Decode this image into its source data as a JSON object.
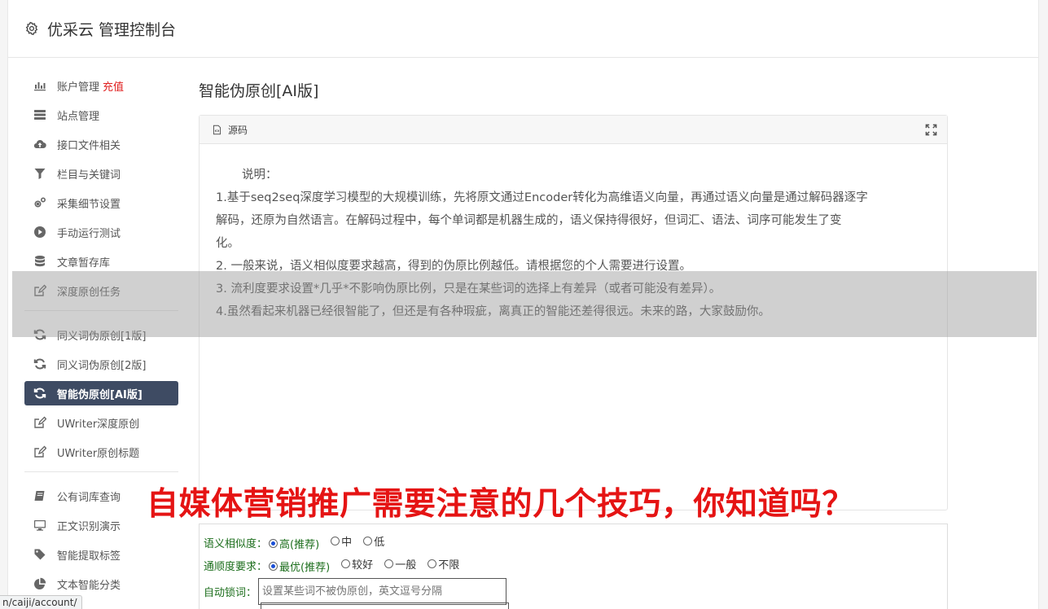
{
  "header": {
    "icon": "gear-icon",
    "title": "优采云 管理控制台"
  },
  "sidebar": {
    "group1": [
      {
        "icon": "bar-chart-icon",
        "label": "账户管理",
        "extra": "充值"
      },
      {
        "icon": "server-icon",
        "label": "站点管理"
      },
      {
        "icon": "cloud-upload-icon",
        "label": "接口文件相关"
      },
      {
        "icon": "filter-icon",
        "label": "栏目与关键词"
      },
      {
        "icon": "cogs-icon",
        "label": "采集细节设置"
      },
      {
        "icon": "play-circle-icon",
        "label": "手动运行测试"
      },
      {
        "icon": "database-icon",
        "label": "文章暂存库"
      },
      {
        "icon": "edit-icon",
        "label": "深度原创任务"
      }
    ],
    "group2": [
      {
        "icon": "refresh-icon",
        "label": "同义词伪原创[1版]"
      },
      {
        "icon": "refresh-icon",
        "label": "同义词伪原创[2版]"
      },
      {
        "icon": "refresh-icon",
        "label": "智能伪原创[AI版]",
        "active": true
      },
      {
        "icon": "edit-icon",
        "label": "UWriter深度原创"
      },
      {
        "icon": "edit-icon",
        "label": "UWriter原创标题"
      }
    ],
    "group3": [
      {
        "icon": "book-icon",
        "label": "公有词库查询"
      },
      {
        "icon": "monitor-icon",
        "label": "正文识别演示"
      },
      {
        "icon": "tag-icon",
        "label": "智能提取标签"
      },
      {
        "icon": "pie-chart-icon",
        "label": "文本智能分类"
      }
    ]
  },
  "main": {
    "page_title": "智能伪原创[AI版]",
    "panel": {
      "tab_label": "源码",
      "description_title": "说明：",
      "lines": [
        "1.基于seq2seq深度学习模型的大规模训练，先将原文通过Encoder转化为高维语义向量，再通过语义向量是通过解码器逐字",
        "解码，还原为自然语言。在解码过程中，每个单词都是机器生成的，语义保持得很好，但词汇、语法、词序可能发生了变",
        "化。",
        "2. 一般来说，语义相似度要求越高，得到的伪原比例越低。请根据您的个人需要进行设置。",
        "3. 流利度要求设置*几乎*不影响伪原比例，只是在某些词的选择上有差异（或者可能没有差异）。",
        "4.虽然看起来机器已经很智能了，但还是有各种瑕疵，离真正的智能还差得很远。未来的路，大家鼓励你。"
      ]
    },
    "options": {
      "similarity": {
        "label": "语义相似度：",
        "choices": [
          {
            "text": "高(推荐)",
            "checked": true
          },
          {
            "text": "中",
            "checked": false
          },
          {
            "text": "低",
            "checked": false
          }
        ]
      },
      "fluency": {
        "label": "通顺度要求：",
        "choices": [
          {
            "text": "最优(推荐)",
            "checked": true
          },
          {
            "text": "较好",
            "checked": false
          },
          {
            "text": "一般",
            "checked": false
          },
          {
            "text": "不限",
            "checked": false
          }
        ]
      },
      "lock_words": {
        "label": "自动锁词：",
        "placeholder": "设置某些词不被伪原创，英文逗号分隔"
      }
    }
  },
  "overlay": {
    "headline": "自媒体营销推广需要注意的几个技巧，你知道吗？"
  },
  "status_bar": {
    "url": "n/caiji/account/"
  }
}
